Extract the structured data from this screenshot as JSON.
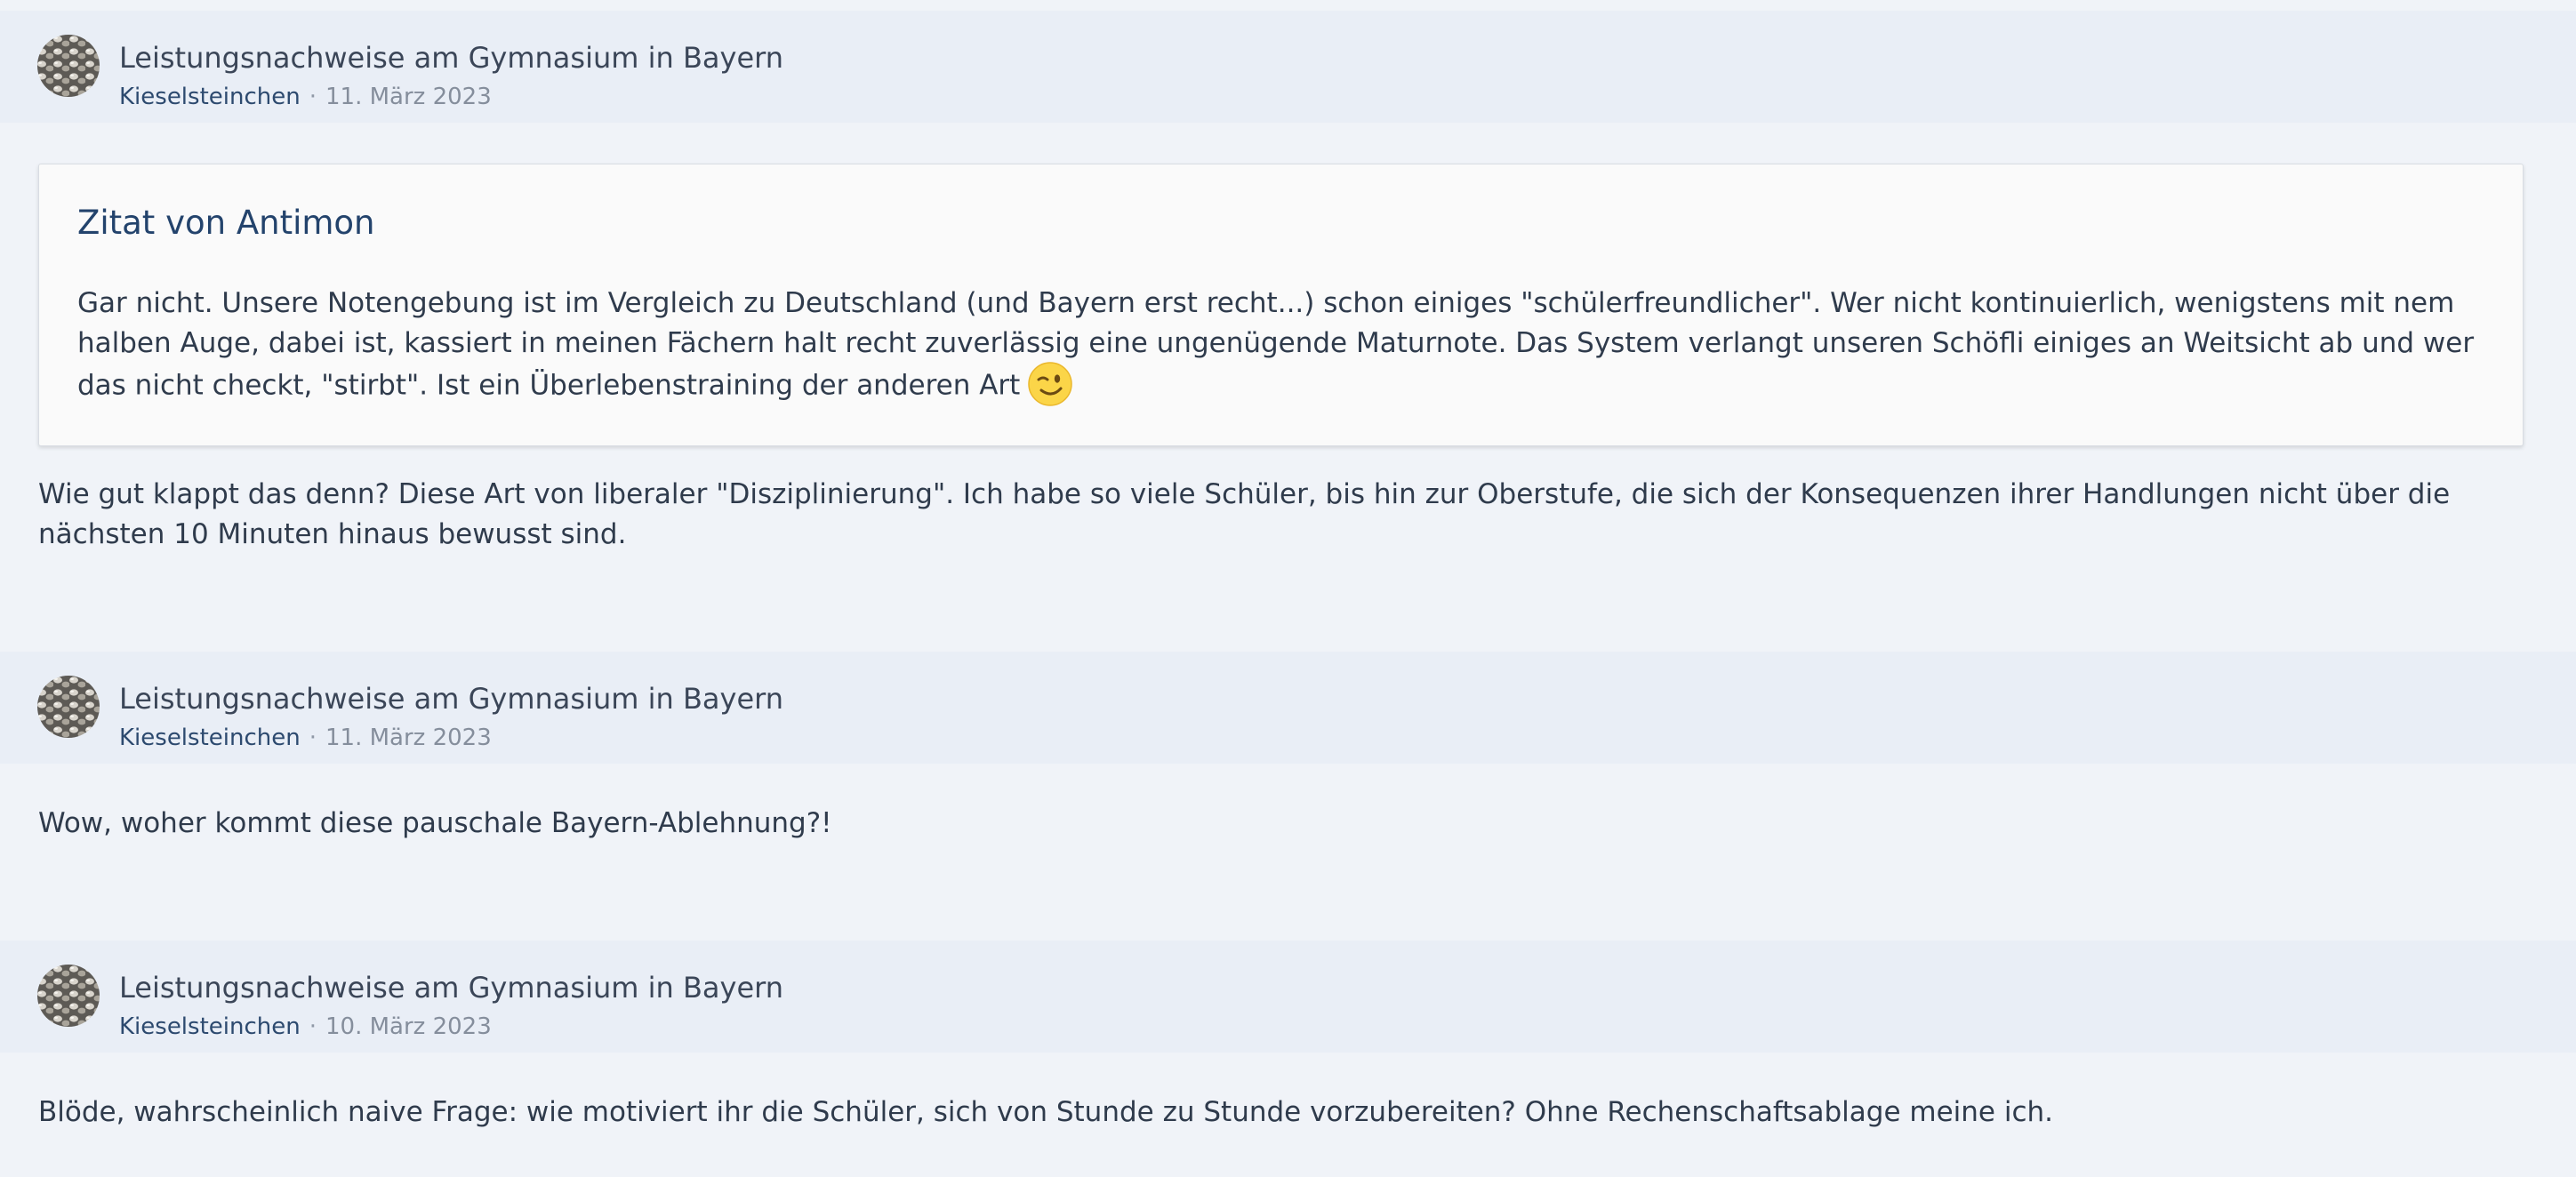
{
  "posts": [
    {
      "title": "Leistungsnachweise am Gymnasium in Bayern",
      "author": "Kieselsteinchen",
      "separator": "·",
      "date": "11. März 2023",
      "quote": {
        "title": "Zitat von Antimon",
        "text": "Gar nicht. Unsere Notengebung ist im Vergleich zu Deutschland (und Bayern erst recht...) schon einiges \"schülerfreundlicher\". Wer nicht kontinuierlich, wenigstens mit nem halben Auge, dabei ist, kassiert in meinen Fächern halt recht zuverlässig eine ungenügende Maturnote. Das System verlangt unseren Schöfli einiges an Weitsicht ab und wer das nicht checkt, \"stirbt\". Ist ein Überlebenstraining der anderen Art",
        "emoji": "winking-face-icon"
      },
      "body": "Wie gut klappt das denn? Diese Art von liberaler \"Disziplinierung\". Ich habe so viele Schüler, bis hin zur Oberstufe, die sich der Konsequenzen ihrer Handlungen nicht über die nächsten 10 Minuten hinaus bewusst sind."
    },
    {
      "title": "Leistungsnachweise am Gymnasium in Bayern",
      "author": "Kieselsteinchen",
      "separator": "·",
      "date": "11. März 2023",
      "body": "Wow, woher kommt diese pauschale Bayern-Ablehnung?!"
    },
    {
      "title": "Leistungsnachweise am Gymnasium in Bayern",
      "author": "Kieselsteinchen",
      "separator": "·",
      "date": "10. März 2023",
      "body": "Blöde, wahrscheinlich naive Frage: wie motiviert ihr die Schüler, sich von Stunde zu Stunde vorzubereiten? Ohne Rechenschaftsablage meine ich."
    }
  ],
  "colors": {
    "page_background": "#f0f3f8",
    "header_background": "#e9eef6",
    "link_color": "#2d4a6f",
    "quote_title_color": "#23436c",
    "text_color": "#2f3b4c"
  }
}
